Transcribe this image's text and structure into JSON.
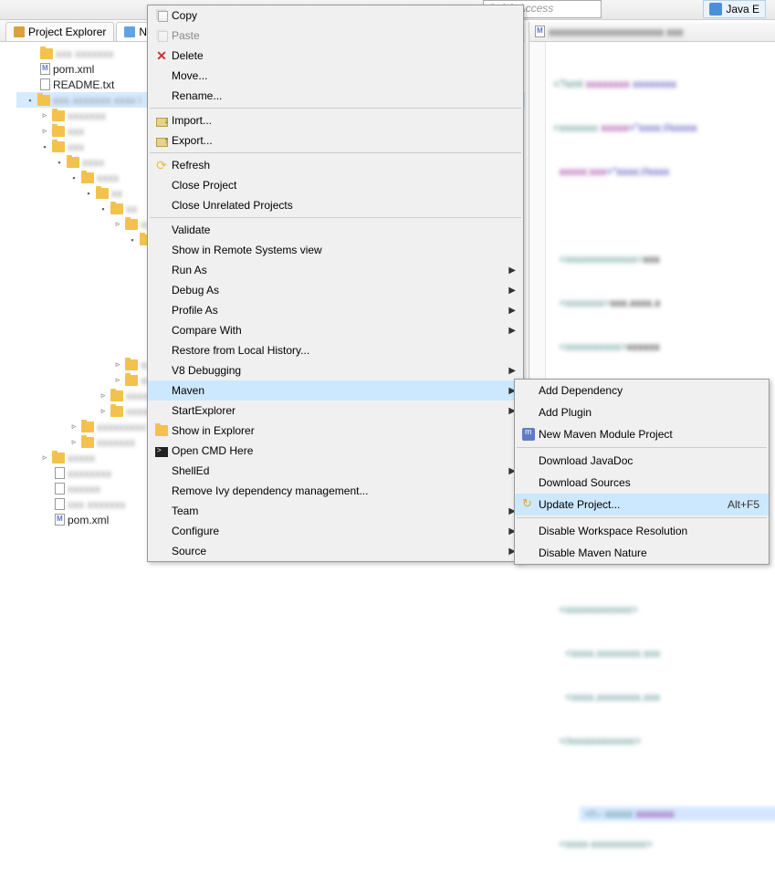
{
  "toolbar": {
    "quick_access_placeholder": "Quick Access",
    "perspective_label": "Java E"
  },
  "tabs": {
    "project_explorer": "Project Explorer",
    "navigator": "Na"
  },
  "tree": {
    "pom_xml": "pom.xml",
    "readme": "README.txt",
    "pom_xml2": "pom.xml"
  },
  "context_menu": {
    "copy": "Copy",
    "paste": "Paste",
    "delete": "Delete",
    "move": "Move...",
    "rename": "Rename...",
    "import": "Import...",
    "export": "Export...",
    "refresh": "Refresh",
    "close_project": "Close Project",
    "close_unrelated": "Close Unrelated Projects",
    "validate": "Validate",
    "remote_systems": "Show in Remote Systems view",
    "run_as": "Run As",
    "debug_as": "Debug As",
    "profile_as": "Profile As",
    "compare_with": "Compare With",
    "restore_history": "Restore from Local History...",
    "v8_debugging": "V8 Debugging",
    "maven": "Maven",
    "start_explorer": "StartExplorer",
    "show_in_explorer": "Show in Explorer",
    "open_cmd": "Open CMD Here",
    "shelled": "ShellEd",
    "remove_ivy": "Remove Ivy dependency management...",
    "team": "Team",
    "configure": "Configure",
    "source": "Source"
  },
  "submenu": {
    "add_dependency": "Add Dependency",
    "add_plugin": "Add Plugin",
    "new_module": "New Maven Module Project",
    "download_javadoc": "Download JavaDoc",
    "download_sources": "Download Sources",
    "update_project": "Update Project...",
    "update_project_shortcut": "Alt+F5",
    "disable_workspace": "Disable Workspace Resolution",
    "disable_nature": "Disable Maven Nature"
  }
}
